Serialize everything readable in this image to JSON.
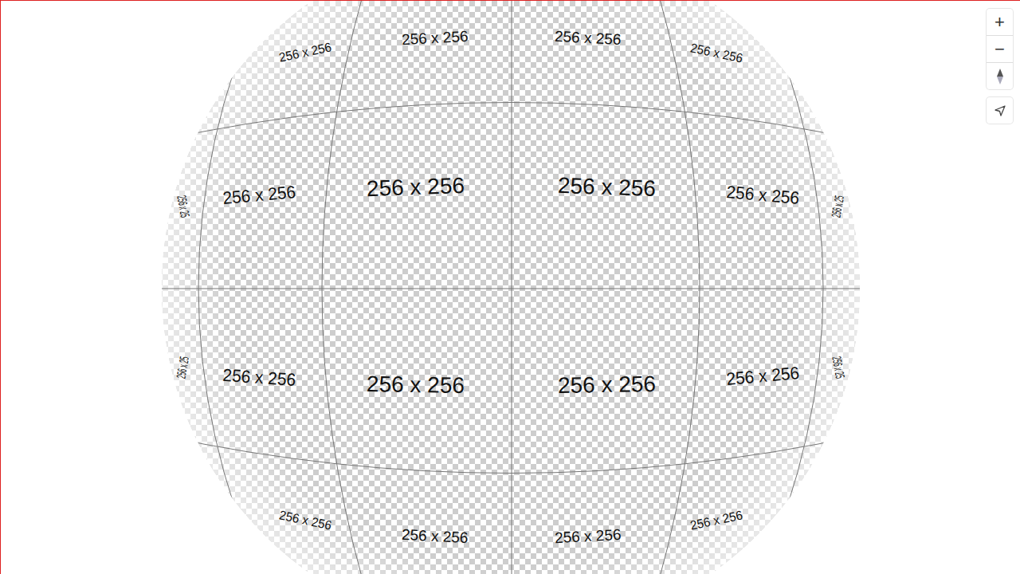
{
  "map": {
    "tile_labels": [
      {
        "text": "256 x 256"
      },
      {
        "text": "256 x 256"
      },
      {
        "text": "256 x 256"
      },
      {
        "text": "256 x 256"
      },
      {
        "text": "256 x 256"
      },
      {
        "text": "256 x 256"
      },
      {
        "text": "256 x 256"
      },
      {
        "text": "256 x 256"
      },
      {
        "text": "256 x 256"
      },
      {
        "text": "256 x 256"
      },
      {
        "text": "256 x 256"
      },
      {
        "text": "256 x 256"
      },
      {
        "text": "256 x 256"
      },
      {
        "text": "256 x 256"
      },
      {
        "text": "256 x 256"
      },
      {
        "text": "256 x 256"
      },
      {
        "text": "256 x 25"
      },
      {
        "text": "256 x 25"
      },
      {
        "text": "256 x 25"
      },
      {
        "text": "256 x 25"
      }
    ]
  },
  "controls": {
    "zoom_in": "+",
    "zoom_out": "−"
  }
}
